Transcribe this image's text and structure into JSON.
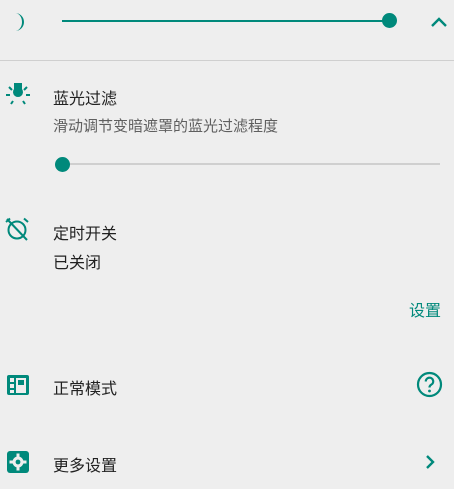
{
  "theme": {
    "accent": "#00897b",
    "background": "#eeeeee"
  },
  "top_bar": {
    "moon_icon": "moon-icon",
    "dim_level": 0.99,
    "collapse_icon": "chevron-up-icon"
  },
  "blue_light": {
    "icon": "bulb-icon",
    "title": "蓝光过滤",
    "subtitle": "滑动调节变暗遮罩的蓝光过滤程度",
    "level": 0.0
  },
  "timer": {
    "icon": "alarm-off-icon",
    "title": "定时开关",
    "status": "已关闭",
    "settings_label": "设置"
  },
  "mode": {
    "icon": "mode-grid-icon",
    "label": "正常模式",
    "help_icon": "help-icon"
  },
  "more": {
    "icon": "gear-icon",
    "label": "更多设置",
    "chevron_icon": "chevron-right-icon"
  }
}
